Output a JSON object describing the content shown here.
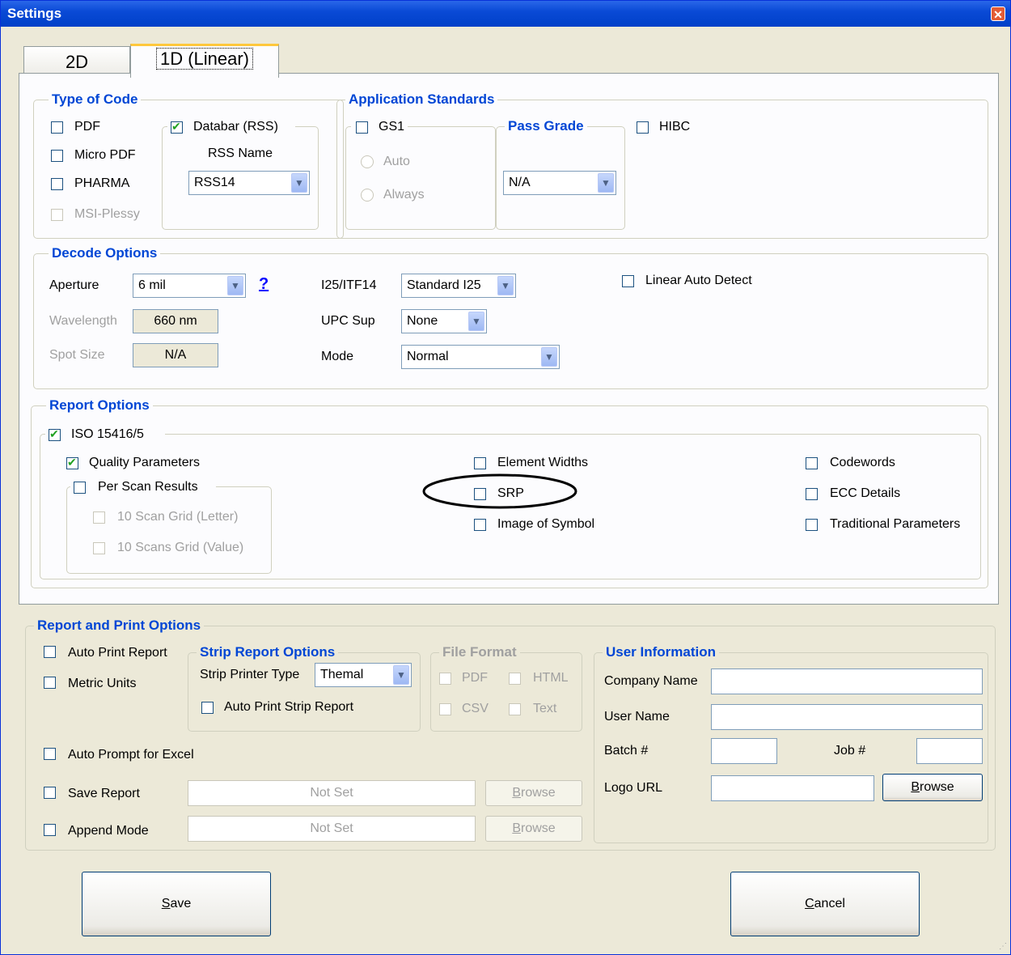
{
  "window": {
    "title": "Settings"
  },
  "tabs": [
    {
      "label": "2D"
    },
    {
      "label": "1D (Linear)"
    }
  ],
  "type_of_code": {
    "title": "Type of Code",
    "pdf": "PDF",
    "micro_pdf": "Micro PDF",
    "pharma": "PHARMA",
    "msi_plessy": "MSI-Plessy",
    "databar": "Databar (RSS)",
    "rss_name_label": "RSS Name",
    "rss_name_value": "RSS14"
  },
  "application_standards": {
    "title": "Application Standards",
    "gs1": "GS1",
    "auto": "Auto",
    "always": "Always",
    "pass_grade_title": "Pass Grade",
    "pass_grade_value": "N/A",
    "hibc": "HIBC"
  },
  "decode_options": {
    "title": "Decode Options",
    "aperture_label": "Aperture",
    "aperture_value": "6 mil",
    "help": "?",
    "wavelength_label": "Wavelength",
    "wavelength_value": "660 nm",
    "spot_size_label": "Spot Size",
    "spot_size_value": "N/A",
    "i25_label": "I25/ITF14",
    "i25_value": "Standard I25",
    "upc_sup_label": "UPC Sup",
    "upc_sup_value": "None",
    "mode_label": "Mode",
    "mode_value": "Normal",
    "linear_auto_detect": "Linear Auto Detect"
  },
  "report_options": {
    "title": "Report Options",
    "iso": "ISO 15416/5",
    "quality_parameters": "Quality Parameters",
    "per_scan_results": "Per Scan Results",
    "scan_grid_letter": "10 Scan Grid (Letter)",
    "scan_grid_value": "10 Scans Grid (Value)",
    "element_widths": "Element Widths",
    "srp": "SRP",
    "image_of_symbol": "Image of Symbol",
    "codewords": "Codewords",
    "ecc_details": "ECC Details",
    "traditional_parameters": "Traditional Parameters"
  },
  "report_print": {
    "title": "Report and Print Options",
    "auto_print_report": "Auto Print Report",
    "metric_units": "Metric Units",
    "auto_prompt_excel": "Auto Prompt for Excel",
    "save_report": "Save Report",
    "append_mode": "Append Mode",
    "save_path": "Not Set",
    "append_path": "Not Set",
    "browse_prefix": "B",
    "browse_rest": "rowse",
    "strip": {
      "title": "Strip Report Options",
      "printer_type_label": "Strip Printer Type",
      "printer_type_value": "Themal",
      "auto_print_strip": "Auto Print Strip Report"
    },
    "file_format": {
      "title": "File Format",
      "pdf": "PDF",
      "html": "HTML",
      "csv": "CSV",
      "text": "Text"
    },
    "user_info": {
      "title": "User Information",
      "company_label": "Company Name",
      "company_value": "",
      "user_label": "User Name",
      "user_value": "",
      "batch_label": "Batch #",
      "batch_value": "",
      "job_label": "Job #",
      "job_value": "",
      "logo_label": "Logo URL",
      "logo_value": ""
    }
  },
  "actions": {
    "save_prefix": "S",
    "save_rest": "ave",
    "cancel_prefix": "C",
    "cancel_rest": "ancel"
  }
}
